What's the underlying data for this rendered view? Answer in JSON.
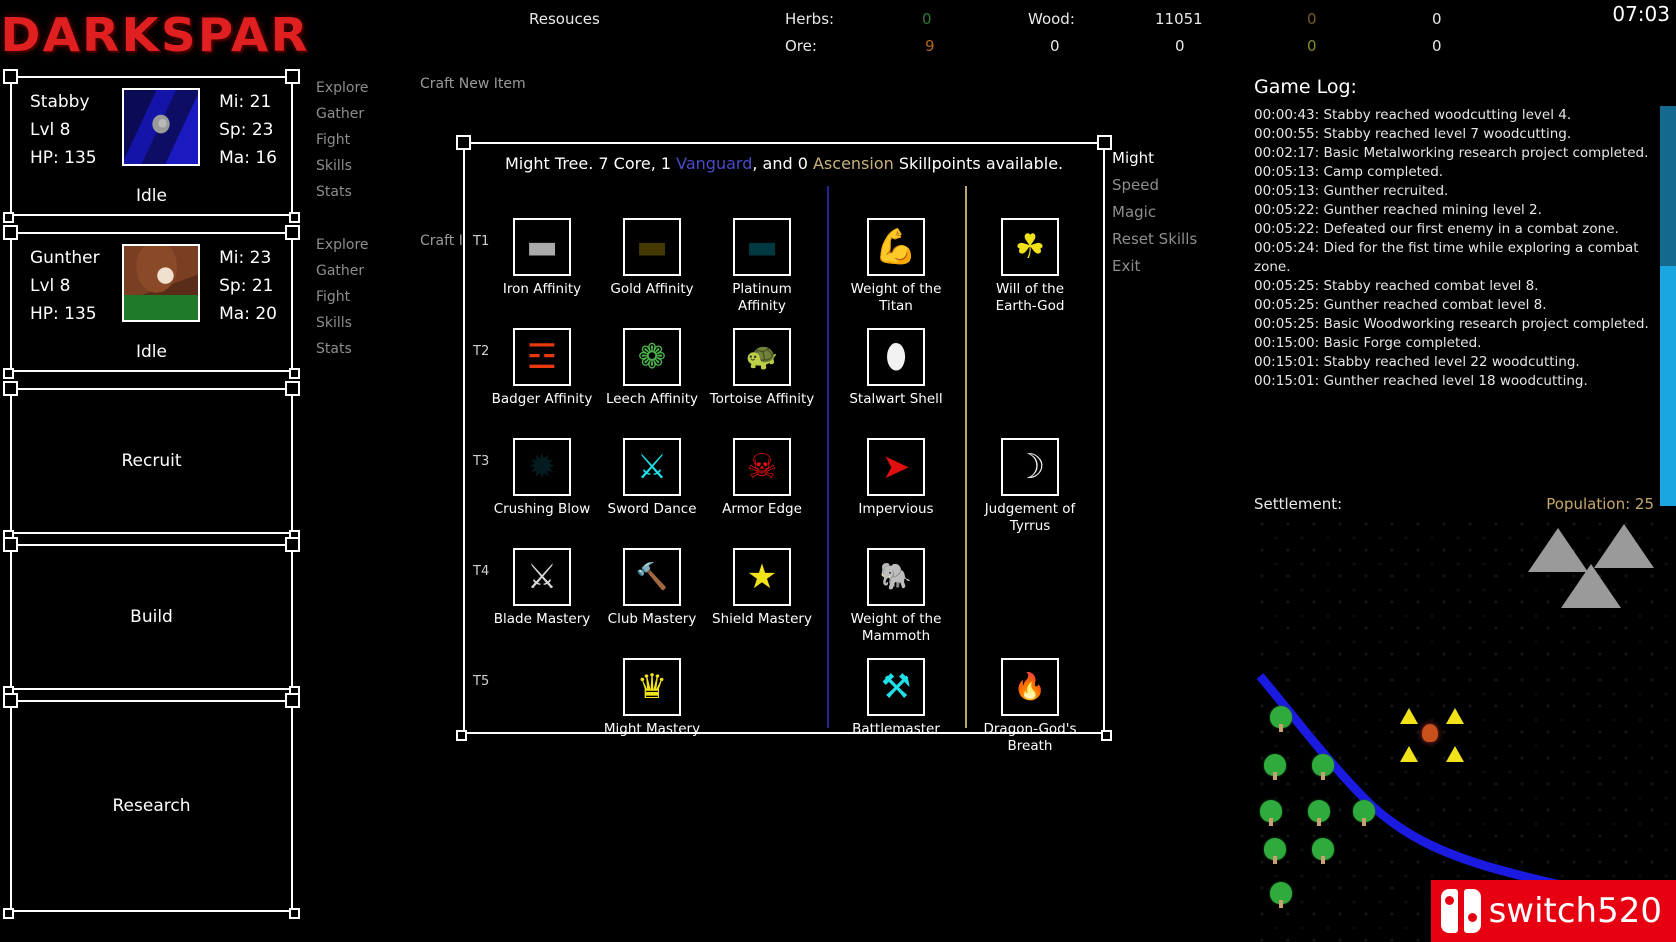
{
  "app": {
    "title": "DARKSPAR",
    "clock": "07:03"
  },
  "resources": {
    "heading": "Resouces",
    "rows": [
      {
        "label": "Herbs:",
        "value": "0",
        "color": "#2f7a2f",
        "c2_label": "Wood:",
        "c2_value": "11051",
        "c3_value": "0",
        "c4_value": "0"
      },
      {
        "label": "Ore:",
        "value": "9",
        "color": "#b5651d",
        "c2_label": "0",
        "c2_value": "0",
        "c3_value": "0",
        "c4_value": "0"
      }
    ]
  },
  "characters": [
    {
      "name": "Stabby",
      "level": "Lvl 8",
      "hp": "HP: 135",
      "mi": "Mi: 21",
      "sp": "Sp: 23",
      "ma": "Ma: 16",
      "status": "Idle",
      "portrait": "stabby-portrait"
    },
    {
      "name": "Gunther",
      "level": "Lvl 8",
      "hp": "HP: 135",
      "mi": "Mi: 23",
      "sp": "Sp: 21",
      "ma": "Ma: 20",
      "status": "Idle",
      "portrait": "gunther-portrait"
    }
  ],
  "actions": [
    {
      "label": "Recruit"
    },
    {
      "label": "Build"
    },
    {
      "label": "Research"
    }
  ],
  "nav_groups": [
    {
      "items": [
        "Explore",
        "Gather",
        "Fight",
        "Skills",
        "Stats"
      ],
      "craft_label": "Craft New Item"
    },
    {
      "items": [
        "Explore",
        "Gather",
        "Fight",
        "Skills",
        "Stats"
      ],
      "craft_label": "Craft I"
    }
  ],
  "tree": {
    "header_prefix": "Might Tree. 7 Core, 1 ",
    "header_vanguard": "Vanguard",
    "header_mid": ", and 0 ",
    "header_ascension": "Ascension",
    "header_suffix": " Skillpoints available.",
    "tiers": [
      "T1",
      "T2",
      "T3",
      "T4",
      "T5"
    ],
    "nodes": [
      {
        "tier": "T1",
        "col": 0,
        "name": "Iron Affinity",
        "icon": "iron-ingot-icon",
        "glyph": "▬",
        "cls": "i-iron"
      },
      {
        "tier": "T1",
        "col": 1,
        "name": "Gold Affinity",
        "icon": "gold-ingot-icon",
        "glyph": "▬",
        "cls": "i-gold"
      },
      {
        "tier": "T1",
        "col": 2,
        "name": "Platinum Affinity",
        "icon": "platinum-ingot-icon",
        "glyph": "▬",
        "cls": "i-plat"
      },
      {
        "tier": "T1",
        "col": 3,
        "name": "Weight of the Titan",
        "icon": "flexing-titan-icon",
        "glyph": "ὊA",
        "cls": "i-titan"
      },
      {
        "tier": "T1",
        "col": 4,
        "name": "Will of the Earth-God",
        "icon": "earth-flame-icon",
        "glyph": "☘",
        "cls": "i-earth"
      },
      {
        "tier": "T2",
        "col": 0,
        "name": "Badger Affinity",
        "icon": "claw-slash-icon",
        "glyph": "☳",
        "cls": "i-badger"
      },
      {
        "tier": "T2",
        "col": 1,
        "name": "Leech Affinity",
        "icon": "leech-icon",
        "glyph": "❁",
        "cls": "i-leech"
      },
      {
        "tier": "T2",
        "col": 2,
        "name": "Tortoise Affinity",
        "icon": "tortoise-icon",
        "glyph": "ὂ2",
        "cls": "i-tort"
      },
      {
        "tier": "T2",
        "col": 3,
        "name": "Stalwart Shell",
        "icon": "turtle-shell-icon",
        "glyph": "⬮",
        "cls": "i-shell"
      },
      {
        "tier": "T3",
        "col": 0,
        "name": "Crushing Blow",
        "icon": "shatter-icon",
        "glyph": "✹",
        "cls": "i-crush"
      },
      {
        "tier": "T3",
        "col": 1,
        "name": "Sword Dance",
        "icon": "spinning-sword-icon",
        "glyph": "⚔",
        "cls": "i-sword"
      },
      {
        "tier": "T3",
        "col": 2,
        "name": "Armor Edge",
        "icon": "red-armor-icon",
        "glyph": "☠",
        "cls": "i-armor"
      },
      {
        "tier": "T3",
        "col": 3,
        "name": "Impervious",
        "icon": "arrow-block-icon",
        "glyph": "➤",
        "cls": "i-imper"
      },
      {
        "tier": "T3",
        "col": 4,
        "name": "Judgement of Tyrrus",
        "icon": "crescent-blade-icon",
        "glyph": "☽",
        "cls": "i-judge"
      },
      {
        "tier": "T4",
        "col": 0,
        "name": "Blade Mastery",
        "icon": "crossed-swords-icon",
        "glyph": "⚔",
        "cls": "i-blade"
      },
      {
        "tier": "T4",
        "col": 1,
        "name": "Club Mastery",
        "icon": "hammer-icon",
        "glyph": "ὒ8",
        "cls": "i-club"
      },
      {
        "tier": "T4",
        "col": 2,
        "name": "Shield Mastery",
        "icon": "shield-star-icon",
        "glyph": "★",
        "cls": "i-shield"
      },
      {
        "tier": "T4",
        "col": 3,
        "name": "Weight of the Mammoth",
        "icon": "mammoth-icon",
        "glyph": "ὁ8",
        "cls": "i-mammoth"
      },
      {
        "tier": "T5",
        "col": 1,
        "name": "Might Mastery",
        "icon": "crown-icon",
        "glyph": "♛",
        "cls": "i-crown"
      },
      {
        "tier": "T5",
        "col": 3,
        "name": "Battlemaster",
        "icon": "shield-swords-icon",
        "glyph": "⚒",
        "cls": "i-battle"
      },
      {
        "tier": "T5",
        "col": 4,
        "name": "Dragon-God's Breath",
        "icon": "dragon-flame-icon",
        "glyph": "ὒ5",
        "cls": "i-dragon"
      }
    ],
    "menu": [
      {
        "label": "Might",
        "active": true
      },
      {
        "label": "Speed",
        "active": false
      },
      {
        "label": "Magic",
        "active": false
      },
      {
        "label": "Reset Skills",
        "active": false
      },
      {
        "label": "Exit",
        "active": false
      }
    ]
  },
  "gamelog": {
    "title": "Game Log:",
    "entries": [
      "00:00:43: Stabby reached woodcutting level 4.",
      "00:00:55: Stabby reached level 7 woodcutting.",
      "00:02:17: Basic Metalworking research project completed.",
      "00:05:13: Camp completed.",
      "00:05:13: Gunther recruited.",
      "00:05:22: Gunther reached mining level 2.",
      "00:05:22: Defeated our first enemy in a combat zone.",
      "00:05:24: Died for the fist time while exploring a combat zone.",
      "00:05:25: Stabby reached combat level 8.",
      "00:05:25: Gunther reached combat level 8.",
      "00:05:25: Basic Woodworking research project completed.",
      "00:15:00: Basic Forge completed.",
      "00:15:01: Stabby reached level 22 woodcutting.",
      "00:15:01: Gunther reached level 18 woodcutting."
    ]
  },
  "settlement": {
    "label": "Settlement:",
    "population": "Population: 25"
  },
  "watermark": {
    "text": "switch520"
  }
}
